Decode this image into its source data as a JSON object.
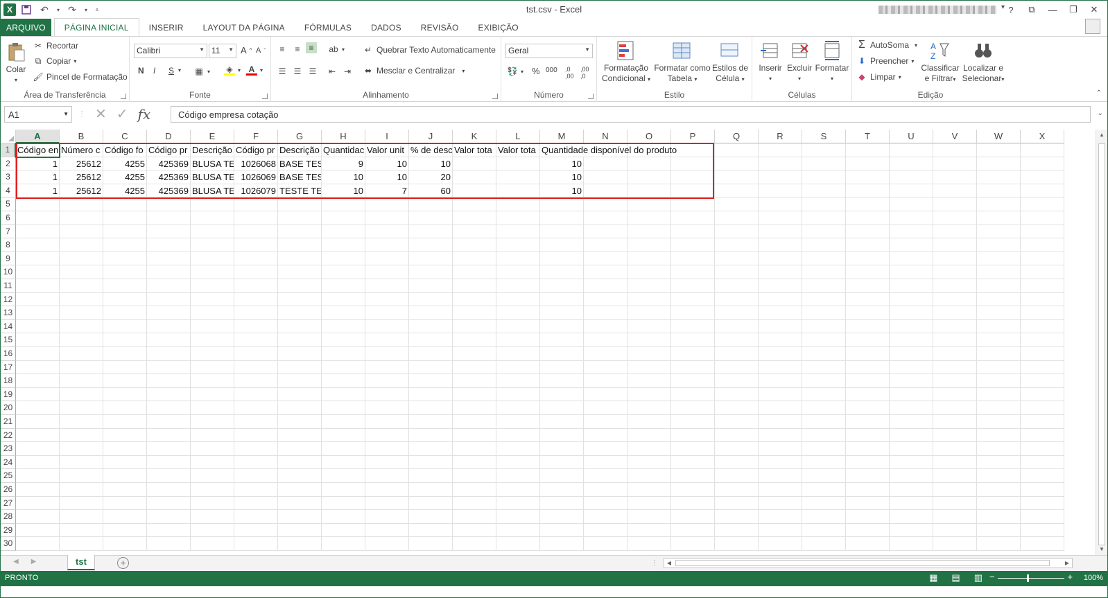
{
  "window": {
    "title": "tst.csv - Excel",
    "help": "?",
    "restore": "❐",
    "minimize": "—",
    "maximize": "❐",
    "close": "✕"
  },
  "ribbon_tabs": [
    "ARQUIVO",
    "PÁGINA INICIAL",
    "INSERIR",
    "LAYOUT DA PÁGINA",
    "FÓRMULAS",
    "DADOS",
    "REVISÃO",
    "EXIBIÇÃO"
  ],
  "active_tab": "PÁGINA INICIAL",
  "clipboard": {
    "paste": "Colar",
    "cut": "Recortar",
    "copy": "Copiar",
    "format_painter": "Pincel de Formatação",
    "label": "Área de Transferência"
  },
  "font": {
    "name": "Calibri",
    "size": "11",
    "bold": "N",
    "italic": "I",
    "underline": "S",
    "label": "Fonte"
  },
  "alignment": {
    "wrap": "Quebrar Texto Automaticamente",
    "merge": "Mesclar e Centralizar",
    "label": "Alinhamento"
  },
  "number": {
    "format": "Geral",
    "percent": "%",
    "thousands": "000",
    "label": "Número"
  },
  "styles": {
    "conditional": [
      "Formatação",
      "Condicional"
    ],
    "table": [
      "Formatar como",
      "Tabela"
    ],
    "cell": [
      "Estilos de",
      "Célula"
    ],
    "label": "Estilo"
  },
  "cells": {
    "insert": "Inserir",
    "delete": "Excluir",
    "format": "Formatar",
    "label": "Células"
  },
  "editing": {
    "autosum": "AutoSoma",
    "fill": "Preencher",
    "clear": "Limpar",
    "sort": [
      "Classificar",
      "e Filtrar"
    ],
    "find": [
      "Localizar e",
      "Selecionar"
    ],
    "label": "Edição"
  },
  "formula_bar": {
    "name_box": "A1",
    "fx": "fx",
    "content": "Código empresa cotação"
  },
  "columns": [
    "A",
    "B",
    "C",
    "D",
    "E",
    "F",
    "G",
    "H",
    "I",
    "J",
    "K",
    "L",
    "M",
    "N",
    "O",
    "P",
    "Q",
    "R",
    "S",
    "T",
    "U",
    "V",
    "W",
    "X"
  ],
  "rows": {
    "count": 30,
    "labels": [
      "1",
      "2",
      "3",
      "4",
      "5",
      "6",
      "7",
      "8",
      "9",
      "10",
      "11",
      "12",
      "13",
      "14",
      "15",
      "16",
      "17",
      "18",
      "19",
      "20",
      "21",
      "22",
      "23",
      "24",
      "25",
      "26",
      "27",
      "28",
      "29",
      "30"
    ]
  },
  "cells_data": {
    "r1": [
      "Código en",
      "Número c",
      "Código fo",
      "Código pr",
      "Descrição",
      "Código pr",
      "Descrição",
      "Quantidac",
      "Valor unit",
      "% de desc",
      "Valor tota",
      "Valor tota",
      "Quantidade disponível do produto"
    ],
    "r2": [
      "1",
      "25612",
      "4255",
      "425369",
      "BLUSA TEF",
      "1026068",
      "BASE TEST",
      "9",
      "10",
      "10",
      "",
      "",
      "10"
    ],
    "r3": [
      "1",
      "25612",
      "4255",
      "425369",
      "BLUSA TEF",
      "1026069",
      "BASE TEST",
      "10",
      "10",
      "20",
      "",
      "",
      "10"
    ],
    "r4": [
      "1",
      "25612",
      "4255",
      "425369",
      "BLUSA TEF",
      "1026079",
      "TESTE TES",
      "10",
      "7",
      "60",
      "",
      "",
      "10"
    ]
  },
  "sheet": {
    "tab": "tst",
    "add": "+"
  },
  "status": {
    "ready": "PRONTO",
    "zoom": "100%"
  },
  "colors": {
    "accent": "#217346",
    "highlight_box": "#e02020"
  }
}
